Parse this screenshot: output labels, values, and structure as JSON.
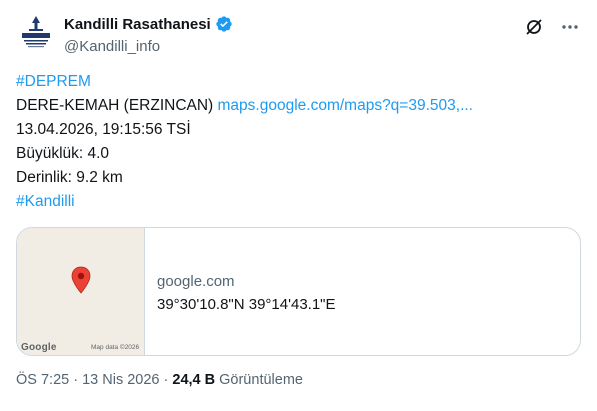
{
  "author": {
    "display_name": "Kandilli Rasathanesi",
    "handle": "@Kandilli_info",
    "verified": true
  },
  "tweet": {
    "hashtag_top": "#DEPREM",
    "location": "DERE-KEMAH (ERZINCAN)",
    "link_text": "maps.google.com/maps?q=39.503,...",
    "datetime": "13.04.2026, 19:15:56 TSİ",
    "magnitude": "Büyüklük: 4.0",
    "depth": "Derinlik: 9.2 km",
    "hashtag_bottom": "#Kandilli"
  },
  "card": {
    "domain": "google.com",
    "coordinates": "39°30'10.8\"N 39°14'43.1\"E",
    "map_logo": "Google",
    "map_data": "Map data ©2026"
  },
  "meta": {
    "time": "ÖS 7:25",
    "separator1": " · ",
    "date": "13 Nis 2026",
    "separator2": " · ",
    "views_count": "24,4 B",
    "views_label": " Görüntüleme"
  },
  "icons": {
    "verified": "verified-badge-icon",
    "grok": "grok-icon",
    "more": "more-icon",
    "pin": "map-pin-icon"
  },
  "colors": {
    "link": "#1d9bf0",
    "secondary_text": "#536471",
    "primary_text": "#0f1419",
    "border": "#cfd9de",
    "pin": "#ea4335"
  }
}
